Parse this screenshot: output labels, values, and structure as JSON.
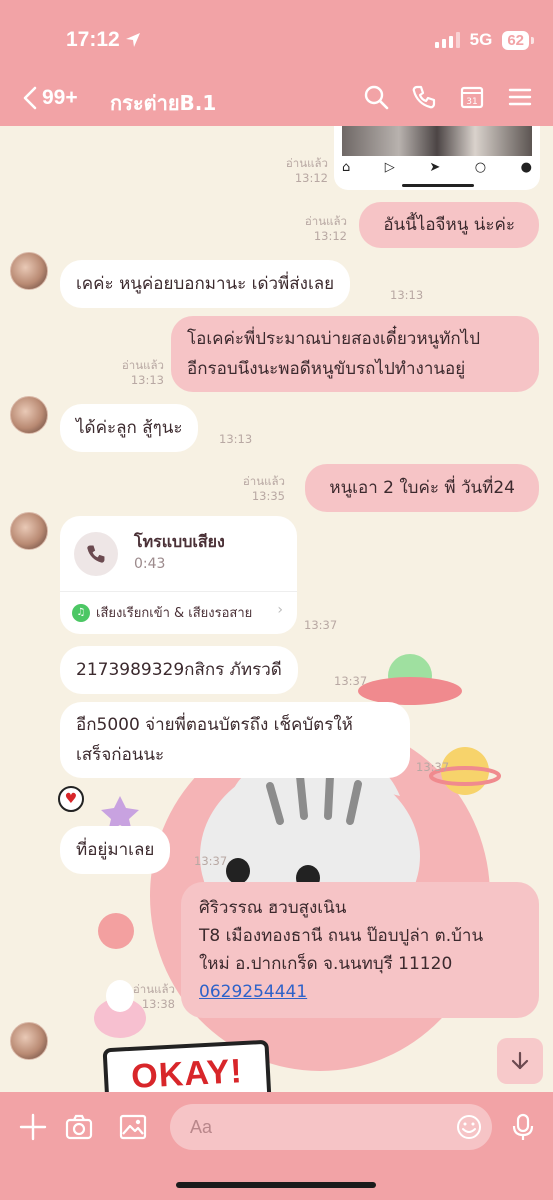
{
  "status_bar": {
    "time": "17:12",
    "network": "5G",
    "battery": "62"
  },
  "header": {
    "back_count": "99+",
    "title": "กระต่ายB.1"
  },
  "messages": [
    {
      "id": "m0",
      "read": "อ่านแล้ว",
      "time": "13:12"
    },
    {
      "id": "m1",
      "read": "อ่านแล้ว",
      "time": "13:12",
      "text": "อันนี้ไอจีหนู น่ะค่ะ"
    },
    {
      "id": "m2",
      "time": "13:13",
      "text": "เคค่ะ หนูค่อยบอกมานะ เด่วพี่ส่งเลย"
    },
    {
      "id": "m3",
      "read": "อ่านแล้ว",
      "time": "13:13",
      "line1": "โอเคค่ะพี่ประมาณบ่ายสองเดี๋ยวหนูทักไป",
      "line2": "อีกรอบนึงนะพอดีหนูขับรถไปทำงานอยู่"
    },
    {
      "id": "m4",
      "time": "13:13",
      "text": "ได้ค่ะลูก สู้ๆนะ"
    },
    {
      "id": "m5",
      "read": "อ่านแล้ว",
      "time": "13:35",
      "text": "หนูเอา 2 ใบค่ะ พี่ วันที่24"
    },
    {
      "id": "m6",
      "time": "13:37",
      "call_title": "โทรแบบเสียง",
      "call_duration": "0:43",
      "call_footer": "เสียงเรียกเข้า & เสียงรอสาย"
    },
    {
      "id": "m7",
      "time": "13:37",
      "text": "2173989329กสิกร ภัทรวดี"
    },
    {
      "id": "m8",
      "time": "13:37",
      "line1": "อีก5000 จ่ายพี่ตอนบัตรถึง เช็คบัตรให้",
      "line2": "เสร็จก่อนนะ"
    },
    {
      "id": "m9",
      "time": "13:37",
      "text": "ที่อยู่มาเลย"
    },
    {
      "id": "m10",
      "read": "อ่านแล้ว",
      "time": "13:38",
      "line1": "ศิริวรรณ ฮวบสูงเนิน",
      "line2": "T8 เมืองทองธานี ถนน ป๊อบปูล่า ต.บ้าน",
      "line3": "ใหม่ อ.ปากเกร็ด จ.นนทบุรี  11120",
      "phone": "0629254441"
    }
  ],
  "sticker_text": "OKAY!",
  "input": {
    "placeholder": "Aa"
  },
  "icons": [
    "back-chevron",
    "search",
    "phone",
    "calendar",
    "menu",
    "plus",
    "camera",
    "image",
    "emoji",
    "microphone",
    "arrow-down"
  ],
  "colors": {
    "header": "#f2a3a6",
    "bubble_out": "#f6c4c6",
    "bubble_in": "#ffffff",
    "background": "#f7f1e3",
    "link": "#2e62c9"
  }
}
